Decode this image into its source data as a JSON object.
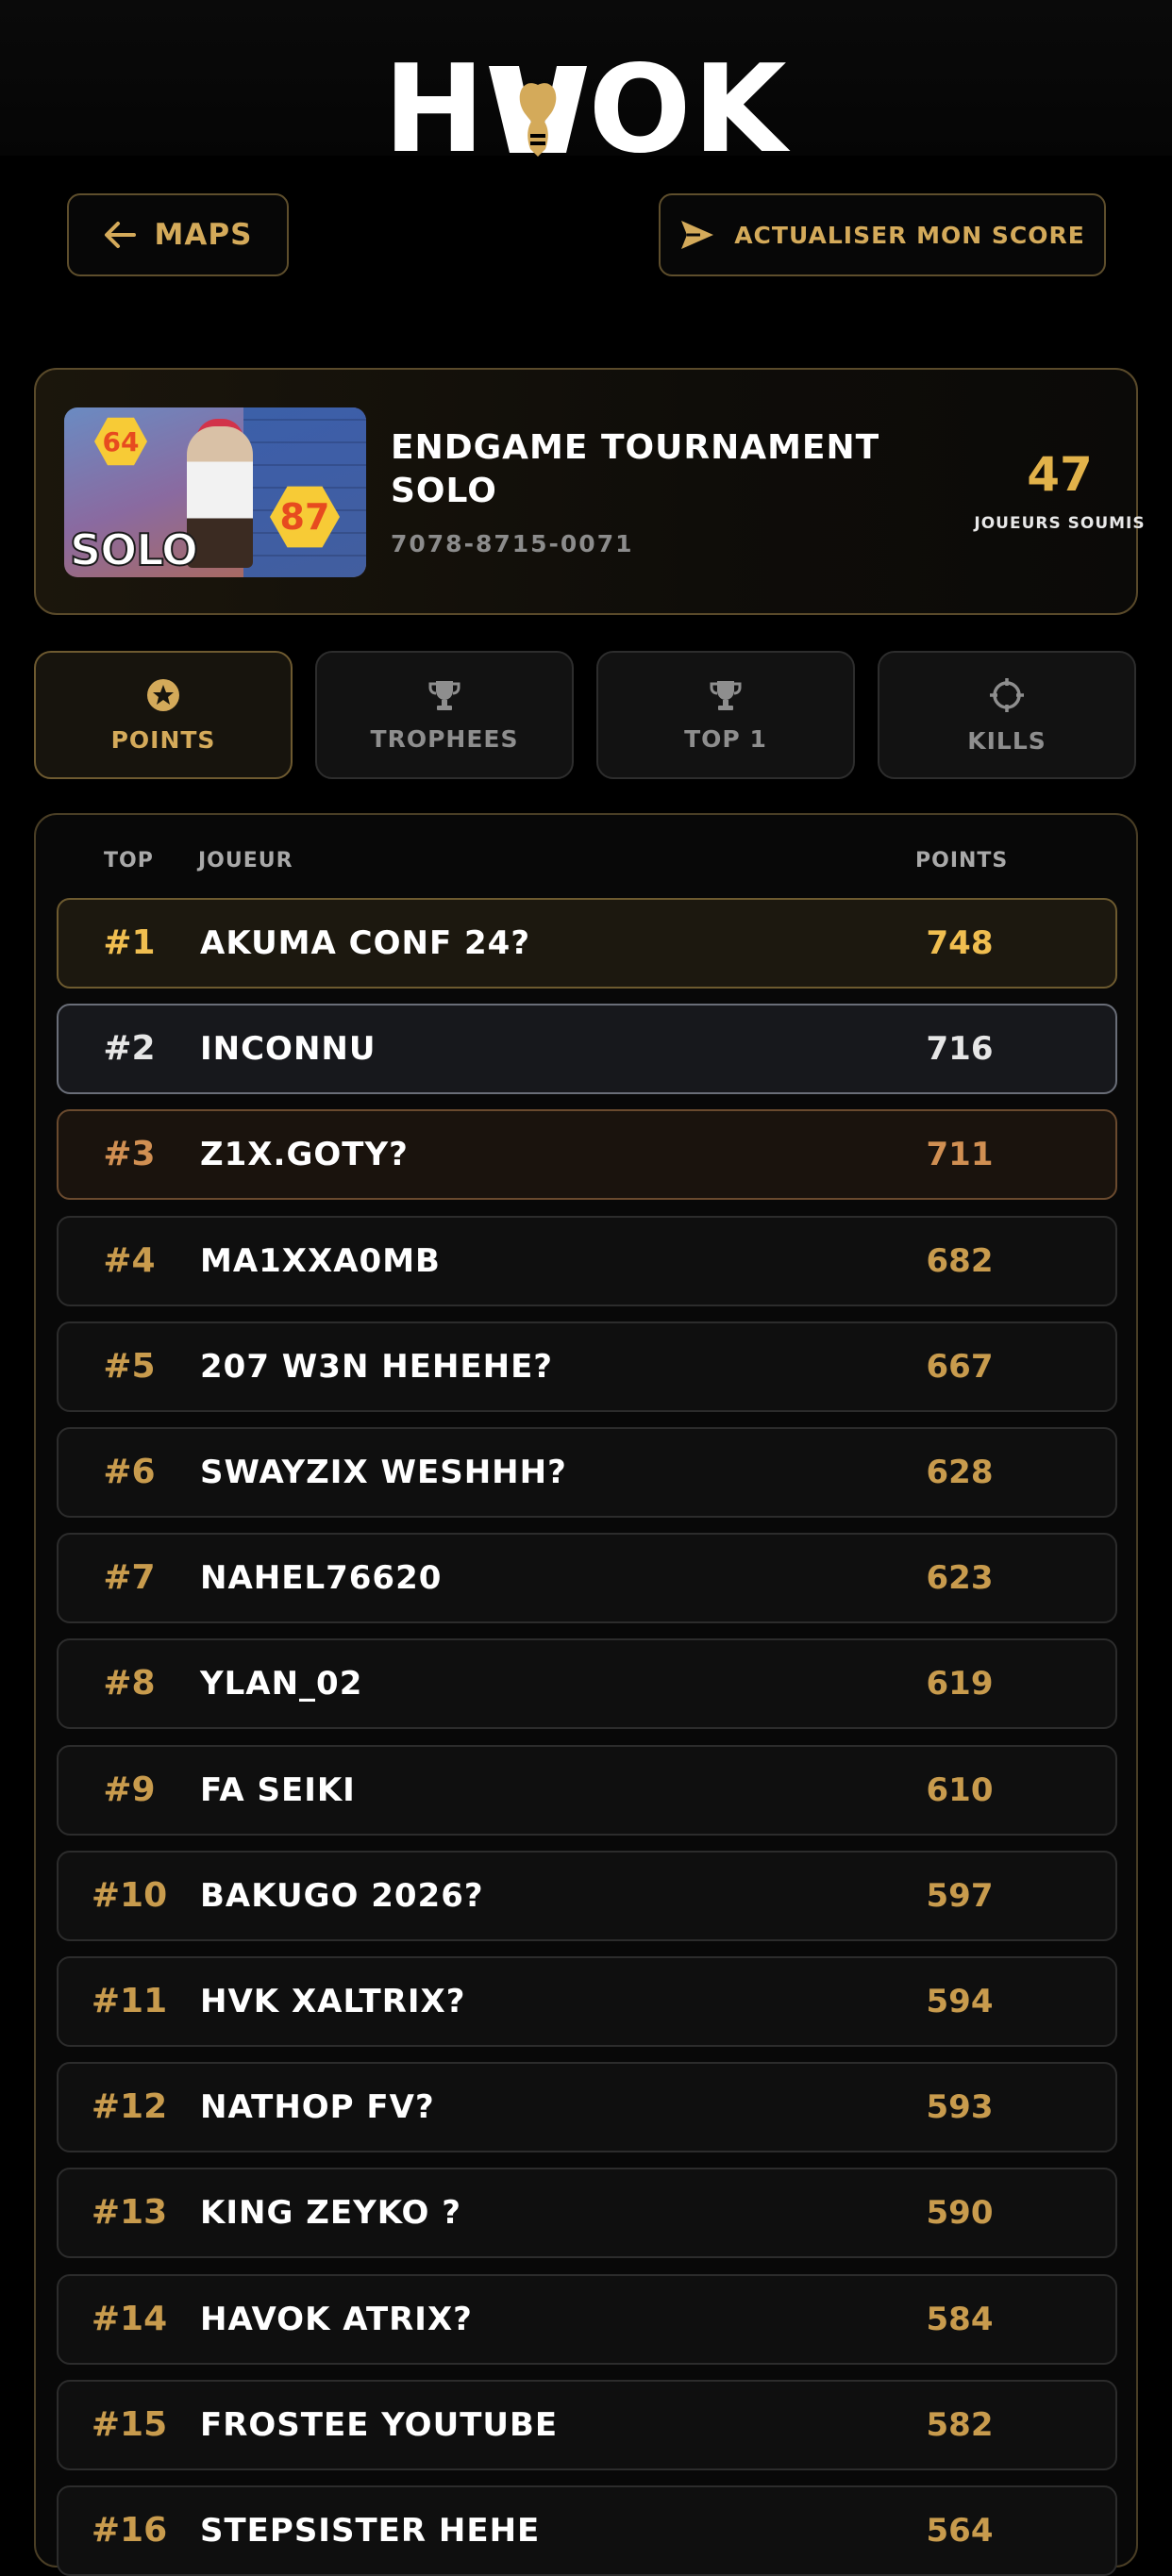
{
  "brand": {
    "logo_text": "HAVOK",
    "logo_left": "H",
    "logo_right": "OK",
    "accent_color": "#d4aa5a"
  },
  "nav": {
    "back_label": "MAPS",
    "update_label": "ACTUALISER MON SCORE"
  },
  "tournament": {
    "title": "ENDGAME TOURNAMENT SOLO",
    "code": "7078-8715-0071",
    "thumbnail_text": "SOLO",
    "thumbnail_badges": [
      "64",
      "87"
    ],
    "players_count": "47",
    "players_label": "JOUEURS SOUMIS"
  },
  "tabs": [
    {
      "label": "POINTS",
      "icon": "star-circle-icon",
      "active": true
    },
    {
      "label": "TROPHEES",
      "icon": "trophy-icon",
      "active": false
    },
    {
      "label": "TOP 1",
      "icon": "trophy-icon",
      "active": false
    },
    {
      "label": "KILLS",
      "icon": "crosshair-icon",
      "active": false
    }
  ],
  "leaderboard": {
    "headers": {
      "top": "TOP",
      "player": "JOUEUR",
      "points": "POINTS"
    },
    "rows": [
      {
        "rank": "#1",
        "player": "AKUMA CONF 24?",
        "points": "748"
      },
      {
        "rank": "#2",
        "player": "INCONNU",
        "points": "716"
      },
      {
        "rank": "#3",
        "player": "Z1X.GOTY?",
        "points": "711"
      },
      {
        "rank": "#4",
        "player": "MA1XXA0MB",
        "points": "682"
      },
      {
        "rank": "#5",
        "player": "207 W3N HEHEHE?",
        "points": "667"
      },
      {
        "rank": "#6",
        "player": "SWAYZIX WESHHH?",
        "points": "628"
      },
      {
        "rank": "#7",
        "player": "NAHEL76620",
        "points": "623"
      },
      {
        "rank": "#8",
        "player": "YLAN_02",
        "points": "619"
      },
      {
        "rank": "#9",
        "player": "FA SEIKI",
        "points": "610"
      },
      {
        "rank": "#10",
        "player": "BAKUGO 2026?",
        "points": "597"
      },
      {
        "rank": "#11",
        "player": "HVK XALTRIX?",
        "points": "594"
      },
      {
        "rank": "#12",
        "player": "NATHOP FV?",
        "points": "593"
      },
      {
        "rank": "#13",
        "player": "KING ZEYKO ?",
        "points": "590"
      },
      {
        "rank": "#14",
        "player": "HAVOK ATRIX?",
        "points": "584"
      },
      {
        "rank": "#15",
        "player": "FROSTEE YOUTUBE",
        "points": "582"
      },
      {
        "rank": "#16",
        "player": "STEPSISTER HEHE",
        "points": "564"
      }
    ]
  }
}
